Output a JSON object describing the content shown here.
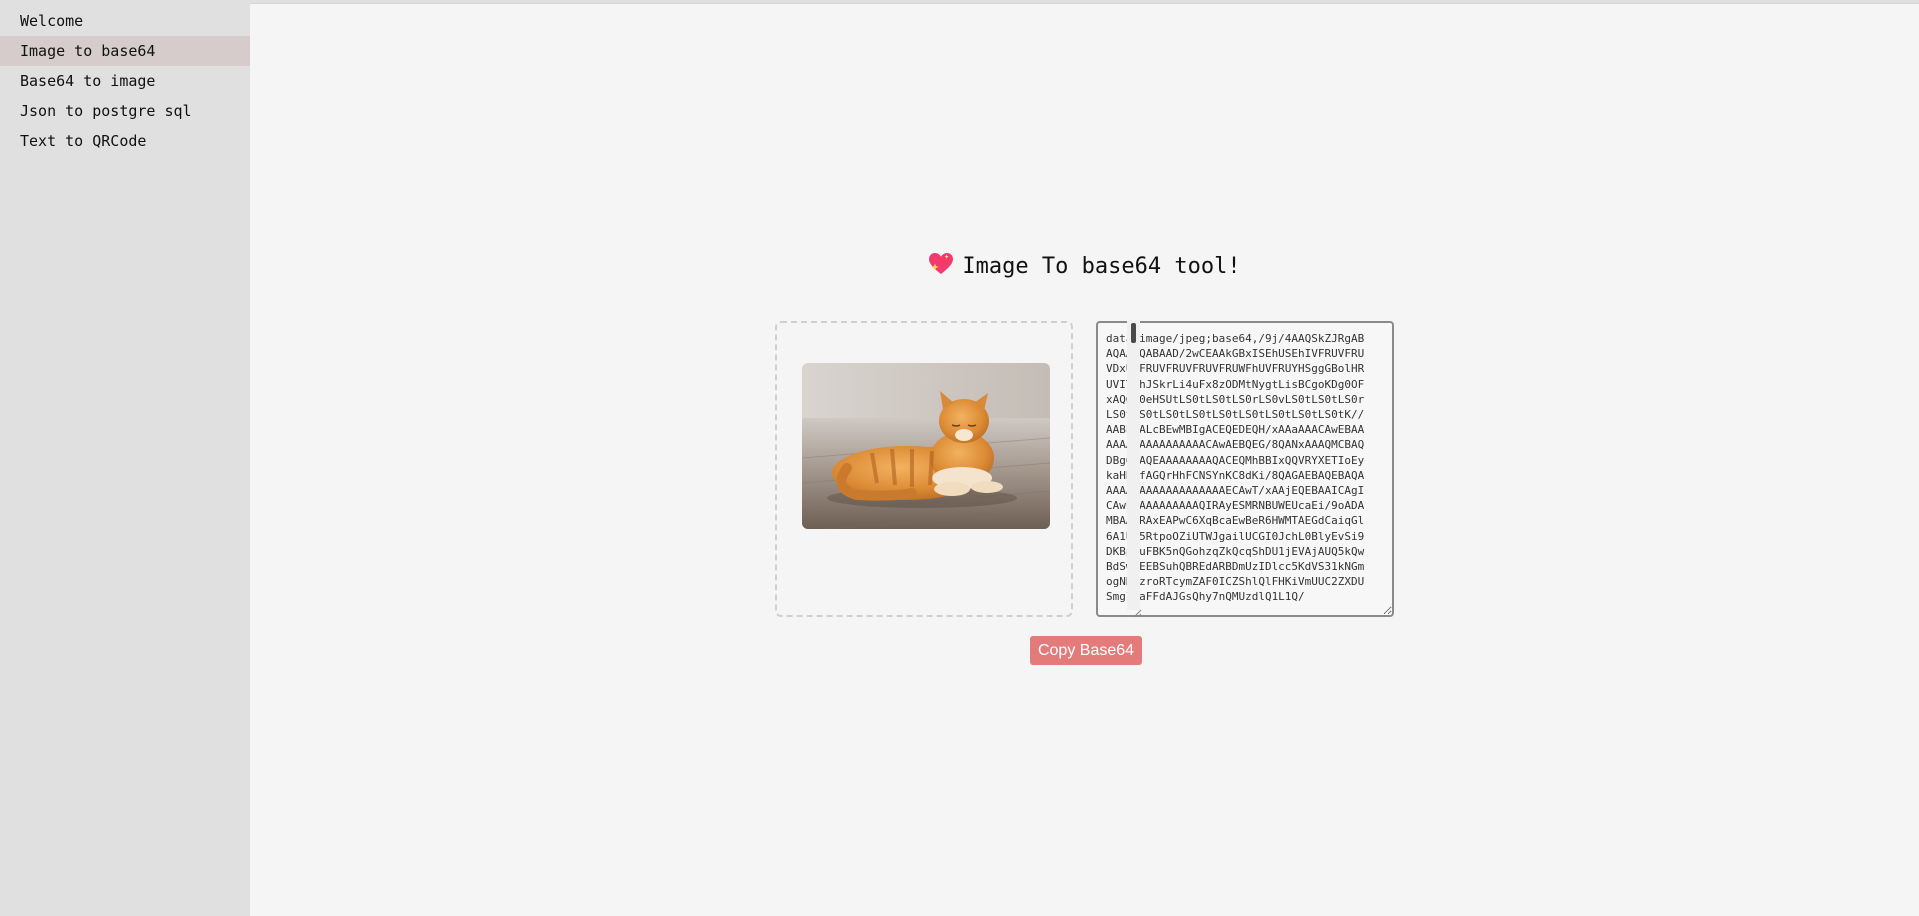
{
  "sidebar": {
    "items": [
      {
        "label": "Welcome"
      },
      {
        "label": "Image to base64"
      },
      {
        "label": "Base64 to image"
      },
      {
        "label": "Json to postgre sql"
      },
      {
        "label": "Text to QRCode"
      }
    ],
    "active_index": 1
  },
  "main": {
    "title": "Image To base64 tool!",
    "heart_icon": "sparkling-heart-icon",
    "output_text": "data:image/jpeg;base64,/9j/4AAQSkZJRgABAQAAAQABAAD/2wCEAAkGBxISEhUSEhIVFRUVFRUVDxUVFRUVFRUVFRUVFRUWFhUVFRUYHSggGBolHRUVITEhJSkrLi4uFx8zODMtNygtLisBCgoKDg0OFxAQGi0eHSUtLS0tLS0tLS0rLS0vLS0tLS0tLS0rLS0tLS0tLS0tLS0tLS0tLS0tLS0tLS0tLS0tK//AABEIALcBEwMBIgACEQEDEQH/xAAaAAACAwEBAAAAAAAAAAAAAAAAACAwAEBQEG/8QANxAAAQMCBAQDBgQHAQEAAAAAAAAQACEQMhBBIxQQVRYXETIoEykaHB0fAGQrHhFCNSYnKC8dKi/8QAGAEBAQEBAQAAAAAAAAAAAAAAAAAAAECAwT/xAAjEQEBAAICAgICAwEAAAAAAAAAAQIRAyESMRNBUWEUcaEi/9oADAMBAAIRAxEAPwC6XqBcaEwBeR6HWMTAEGdCaiqGl6A1Uu5RtpoOZiUTWJgailUCGI0JchL0BlyEvSi9DKBpcuFBK5nQGohzqZkQcqShDU1jEVAjAUQ5kQwBdSw5EEBSuhQBREdARBDmUzIDlcc5KdVS31kNGmogNRIzroRTcymZAF0ICZShlQlFHKiVmUUC2ZXDUSmglMaFFdAJGsQhy7nQMUzdlQ1L1Q/",
    "copy_button_label": "Copy Base64"
  },
  "icons": {
    "preview_image": "cat-photo",
    "resize_grip": "resize-grip-icon"
  },
  "colors": {
    "sidebar_bg": "#e0e0e0",
    "sidebar_active_bg": "#d6cccc",
    "page_bg": "#f5f5f5",
    "button_bg": "#e47b7b"
  }
}
